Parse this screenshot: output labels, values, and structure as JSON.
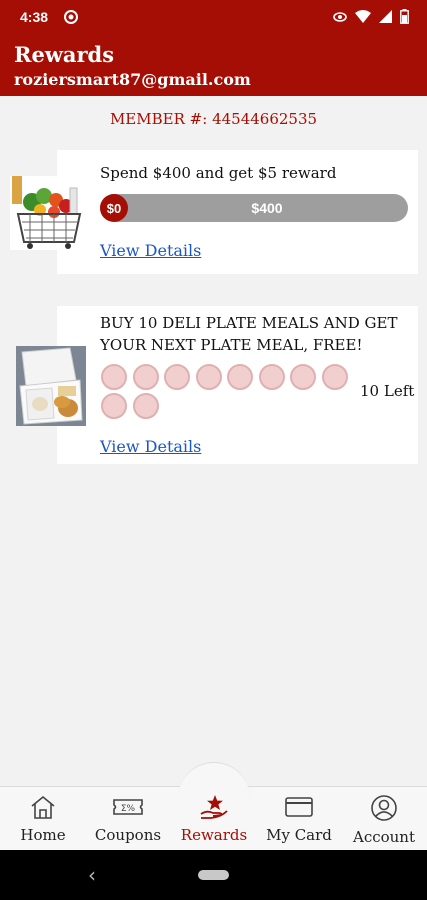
{
  "status_bar": {
    "time": "4:38",
    "icons": [
      "app-notification-icon",
      "eye-icon",
      "wifi-icon",
      "signal-icon",
      "battery-icon"
    ]
  },
  "header": {
    "title": "Rewards",
    "email": "roziersmart87@gmail.com"
  },
  "member": {
    "label": "MEMBER #:",
    "number": "44544662535"
  },
  "rewards": [
    {
      "title": "Spend $400 and get $5 reward",
      "progress_start": "$0",
      "progress_goal": "$400",
      "progress_fraction": 0,
      "link": "View Details",
      "image": "grocery-basket"
    },
    {
      "title": "BUY 10 DELI PLATE MEALS AND GET YOUR NEXT PLATE MEAL, FREE!",
      "stamps_total": 10,
      "stamps_filled": 0,
      "remaining": "10 Left",
      "link": "View Details",
      "image": "deli-plate-meal"
    }
  ],
  "nav": {
    "items": [
      {
        "label": "Home",
        "icon": "home-icon"
      },
      {
        "label": "Coupons",
        "icon": "coupon-icon"
      },
      {
        "label": "Rewards",
        "icon": "rewards-star-icon",
        "active": true
      },
      {
        "label": "My Card",
        "icon": "card-icon"
      },
      {
        "label": "Account",
        "icon": "account-icon"
      }
    ]
  },
  "colors": {
    "brand": "#a50e04",
    "link": "#1a56c8",
    "stamp": "#f1cfcf"
  }
}
